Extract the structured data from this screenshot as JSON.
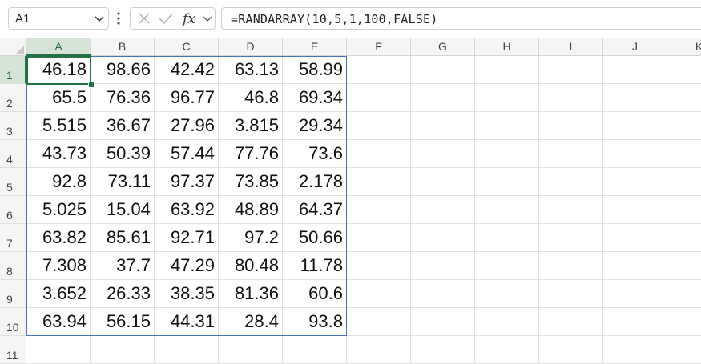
{
  "formula_bar": {
    "name_box": "A1",
    "formula": "=RANDARRAY(10,5,1,100,FALSE)"
  },
  "icons": {
    "name_dropdown": "chevron-down-icon",
    "more": "vertical-ellipsis-icon",
    "cancel": "close-icon",
    "enter": "checkmark-icon",
    "function": "fx-icon",
    "fx_dropdown": "chevron-down-icon"
  },
  "colors": {
    "active_cell": "#217346",
    "spill_range": "#4472c4",
    "header_bg": "#f5f5f5"
  },
  "columns": [
    "A",
    "B",
    "C",
    "D",
    "E",
    "F",
    "G",
    "H",
    "I",
    "J",
    "K"
  ],
  "rows": [
    "1",
    "2",
    "3",
    "4",
    "5",
    "6",
    "7",
    "8",
    "9",
    "10",
    "11"
  ],
  "cells": [
    [
      "46.18",
      "98.66",
      "42.42",
      "63.13",
      "58.99"
    ],
    [
      "65.5",
      "76.36",
      "96.77",
      "46.8",
      "69.34"
    ],
    [
      "5.515",
      "36.67",
      "27.96",
      "3.815",
      "29.34"
    ],
    [
      "43.73",
      "50.39",
      "57.44",
      "77.76",
      "73.6"
    ],
    [
      "92.8",
      "73.11",
      "97.37",
      "73.85",
      "2.178"
    ],
    [
      "5.025",
      "15.04",
      "63.92",
      "48.89",
      "64.37"
    ],
    [
      "63.82",
      "85.61",
      "92.71",
      "97.2",
      "50.66"
    ],
    [
      "7.308",
      "37.7",
      "47.29",
      "80.48",
      "11.78"
    ],
    [
      "3.652",
      "26.33",
      "38.35",
      "81.36",
      "60.6"
    ],
    [
      "63.94",
      "56.15",
      "44.31",
      "28.4",
      "93.8"
    ]
  ]
}
